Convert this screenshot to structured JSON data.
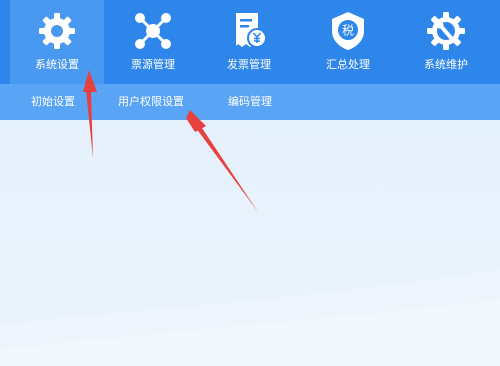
{
  "top_nav": [
    {
      "label": "系统设置",
      "icon": "gear-icon"
    },
    {
      "label": "票源管理",
      "icon": "network-nodes-icon"
    },
    {
      "label": "发票管理",
      "icon": "invoice-yen-icon"
    },
    {
      "label": "汇总处理",
      "icon": "tax-shield-icon"
    },
    {
      "label": "系统维护",
      "icon": "wrench-gear-icon"
    }
  ],
  "active_nav": "系统设置",
  "sub_nav": [
    {
      "label": "初始设置"
    },
    {
      "label": "用户权限设置"
    },
    {
      "label": "编码管理"
    }
  ],
  "colors": {
    "top_bar": "#2f86ea",
    "active_tab": "#4a99f0",
    "sub_bar": "#5aa4f5",
    "content_bg": "#e6f1fb",
    "annotation_arrow": "#e8403f"
  }
}
